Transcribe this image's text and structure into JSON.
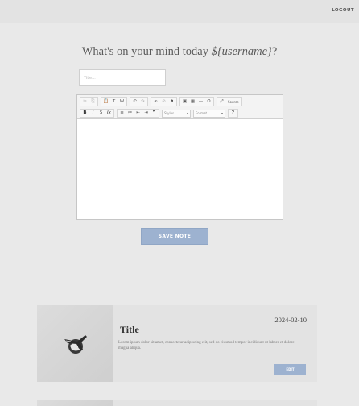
{
  "header": {
    "logout_label": "LOGOUT"
  },
  "main": {
    "heading_text": "What's on your mind today ",
    "heading_var": "${username}",
    "heading_suffix": "?",
    "title_placeholder": "Title...",
    "save_label": "SAVE NOTE"
  },
  "editor": {
    "row1": [
      {
        "icon": "cut-icon",
        "glyph": "✂",
        "enabled": false
      },
      {
        "icon": "copy-icon",
        "glyph": "⎘",
        "enabled": false
      },
      {
        "icon": "paste-icon",
        "glyph": "📋",
        "enabled": true
      },
      {
        "icon": "paste-text-icon",
        "glyph": "T",
        "enabled": true
      },
      {
        "icon": "paste-word-icon",
        "glyph": "W",
        "enabled": true
      },
      {
        "icon": "undo-icon",
        "glyph": "↶",
        "enabled": true
      },
      {
        "icon": "redo-icon",
        "glyph": "↷",
        "enabled": false
      },
      {
        "icon": "link-icon",
        "glyph": "∞",
        "enabled": true
      },
      {
        "icon": "unlink-icon",
        "glyph": "⊘",
        "enabled": false
      },
      {
        "icon": "anchor-icon",
        "glyph": "⚑",
        "enabled": true
      },
      {
        "icon": "image-icon",
        "glyph": "▣",
        "enabled": true
      },
      {
        "icon": "table-icon",
        "glyph": "▦",
        "enabled": true
      },
      {
        "icon": "horizontal-rule-icon",
        "glyph": "—",
        "enabled": true
      },
      {
        "icon": "special-char-icon",
        "glyph": "Ω",
        "enabled": true
      },
      {
        "icon": "maximize-icon",
        "glyph": "⤢",
        "enabled": true
      }
    ],
    "source_label": "Source",
    "row2": [
      {
        "icon": "bold-icon",
        "glyph": "B",
        "style": "bold"
      },
      {
        "icon": "italic-icon",
        "glyph": "I",
        "style": "ital"
      },
      {
        "icon": "strike-icon",
        "glyph": "S",
        "style": ""
      },
      {
        "icon": "remove-format-icon",
        "glyph": "Ix",
        "style": "ital"
      },
      {
        "icon": "numbered-list-icon",
        "glyph": "≡",
        "style": ""
      },
      {
        "icon": "bulleted-list-icon",
        "glyph": "≔",
        "style": ""
      },
      {
        "icon": "outdent-icon",
        "glyph": "⇤",
        "style": ""
      },
      {
        "icon": "indent-icon",
        "glyph": "⇥",
        "style": ""
      },
      {
        "icon": "blockquote-icon",
        "glyph": "❞",
        "style": "bold"
      }
    ],
    "styles_label": "Styles",
    "format_label": "Format",
    "help_glyph": "?"
  },
  "note": {
    "date": "2024-02-10",
    "title": "Title",
    "text": "Lorem ipsum dolor sit amet, consectetur adipiscing elit, sed do eiusmod tempor incididunt ut labore et dolore magna aliqua.",
    "edit_label": "EDIT"
  },
  "colors": {
    "accent": "#9db2d0",
    "background": "#e9e9e9",
    "card": "#e3e3e3"
  }
}
